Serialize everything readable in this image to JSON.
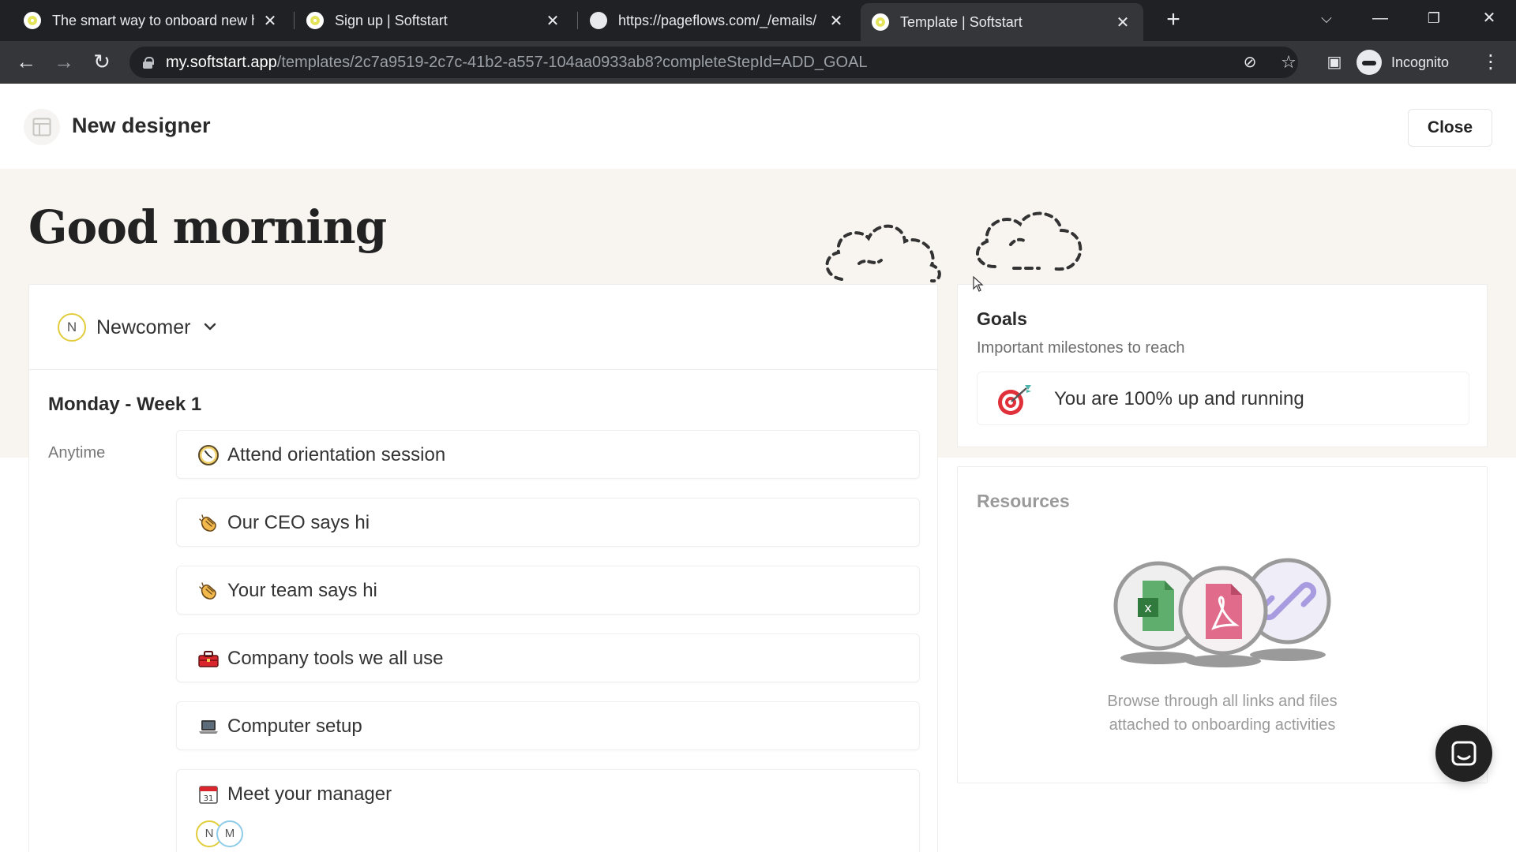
{
  "browser": {
    "tabs": [
      {
        "title": "The smart way to onboard new h",
        "active": false,
        "favicon": "softstart-icon"
      },
      {
        "title": "Sign up | Softstart",
        "active": false,
        "favicon": "softstart-icon"
      },
      {
        "title": "https://pageflows.com/_/emails/",
        "active": false,
        "favicon": "globe-icon"
      },
      {
        "title": "Template | Softstart",
        "active": true,
        "favicon": "softstart-icon"
      }
    ],
    "url_host": "my.softstart.app",
    "url_path": "/templates/2c7a9519-2c7c-41b2-a557-104aa0933ab8?completeStepId=ADD_GOAL",
    "profile_label": "Incognito"
  },
  "header": {
    "title": "New designer",
    "close_label": "Close"
  },
  "hero": {
    "greeting": "Good morning"
  },
  "main": {
    "role": {
      "initial": "N",
      "name": "Newcomer"
    },
    "day_title": "Monday - Week 1",
    "slot_label": "Anytime",
    "tasks": [
      {
        "emoji": "clock-icon",
        "label": "Attend orientation session"
      },
      {
        "emoji": "clapping-hands-icon",
        "label": "Our CEO says hi"
      },
      {
        "emoji": "clapping-hands-icon",
        "label": "Your team says hi"
      },
      {
        "emoji": "toolbox-icon",
        "label": "Company tools we all use"
      },
      {
        "emoji": "laptop-icon",
        "label": "Computer setup"
      },
      {
        "emoji": "calendar-icon",
        "label": "Meet your manager",
        "assignees": [
          "N",
          "M"
        ]
      }
    ]
  },
  "goals": {
    "title": "Goals",
    "subtitle": "Important milestones to reach",
    "item": "You are 100% up and running"
  },
  "resources": {
    "title": "Resources",
    "desc_line1": "Browse through all links and files",
    "desc_line2": "attached to onboarding activities"
  },
  "colors": {
    "hero_bg": "#f8f5f1",
    "accent_yellow": "#e1cd3c",
    "accent_blue": "#8ecbe8",
    "excel_green": "#5fae6d",
    "pdf_pink": "#e06b8b",
    "link_purple": "#a99be0"
  }
}
